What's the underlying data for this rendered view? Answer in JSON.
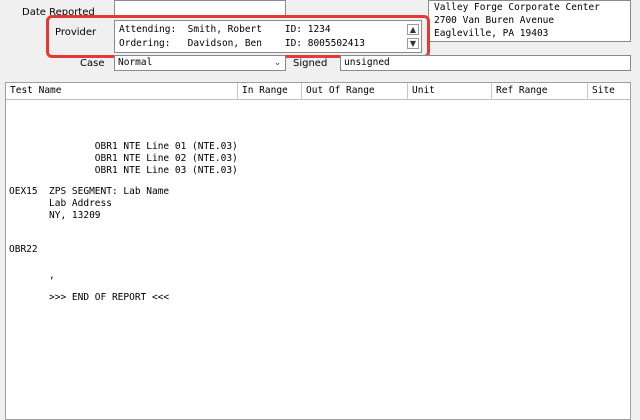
{
  "form": {
    "date_reported_label": "Date Reported",
    "date_reported_value": "",
    "provider_label": "Provider",
    "provider_lines": [
      "Attending:  Smith, Robert    ID: 1234",
      "Ordering:   Davidson, Ben    ID: 8005502413"
    ],
    "case_label": "Case",
    "case_value": "Normal",
    "signed_label": "Signed",
    "signed_value": "unsigned"
  },
  "address": {
    "line1": "Valley Forge Corporate Center",
    "line2": "2700 Van Buren Avenue",
    "line3": "Eagleville, PA 19403"
  },
  "table": {
    "columns": [
      "Test Name",
      "In Range",
      "Out Of Range",
      "Unit",
      "Ref Range",
      "Site"
    ]
  },
  "report": {
    "lines": [
      "               OBR1 NTE Line 01 (NTE.03)",
      "               OBR1 NTE Line 02 (NTE.03)",
      "               OBR1 NTE Line 03 (NTE.03)",
      "OEX15  ZPS SEGMENT: Lab Name",
      "       Lab Address",
      "       NY, 13209",
      "OBR22",
      "       ,",
      "       >>> END OF REPORT <<<"
    ]
  },
  "icons": {
    "dropdown": "chevron-down-icon",
    "scroll_up": "scroll-up-icon",
    "scroll_down": "scroll-down-icon"
  },
  "colors": {
    "highlight": "#e53935",
    "window_bg": "#f0f0f0",
    "field_bg": "#ffffff"
  }
}
